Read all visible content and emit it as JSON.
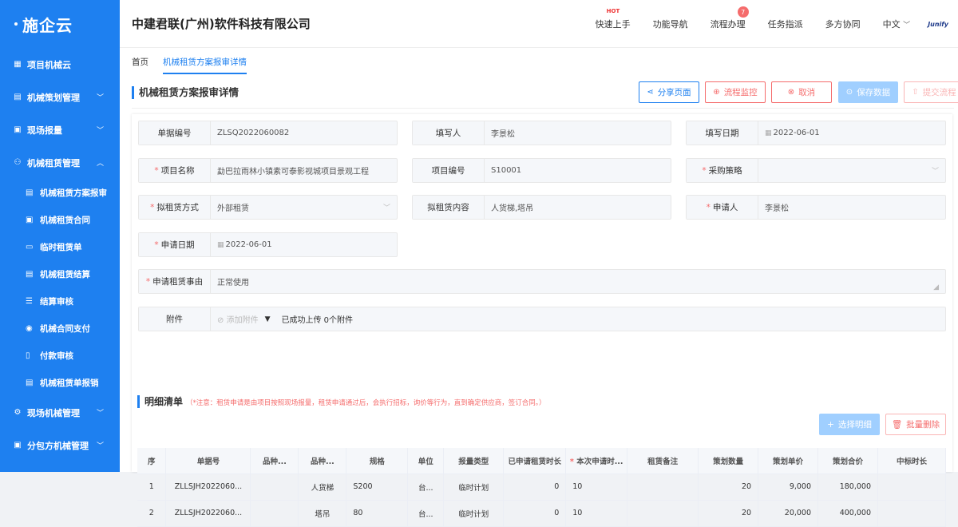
{
  "brand": {
    "logo_text": "施企云"
  },
  "sidebar": {
    "items": [
      {
        "label": "项目机械云"
      },
      {
        "label": "机械策划管理"
      },
      {
        "label": "现场报量"
      },
      {
        "label": "机械租赁管理"
      },
      {
        "label": "现场机械管理"
      },
      {
        "label": "分包方机械管理"
      }
    ],
    "sub_items": [
      {
        "label": "机械租赁方案报审"
      },
      {
        "label": "机械租赁合同"
      },
      {
        "label": "临时租赁单"
      },
      {
        "label": "机械租赁结算"
      },
      {
        "label": "结算审核"
      },
      {
        "label": "机械合同支付"
      },
      {
        "label": "付款审核"
      },
      {
        "label": "机械租赁单报销"
      }
    ]
  },
  "header": {
    "company": "中建君联(广州)软件科技有限公司",
    "nav": [
      "快速上手",
      "功能导航",
      "流程办理",
      "任务指派",
      "多方协同",
      "中文"
    ],
    "hot": "HOT",
    "badge": "7",
    "brandmark": "Junify"
  },
  "breadcrumb": [
    "首页",
    "机械租赁方案报审详情"
  ],
  "page": {
    "title": "机械租赁方案报审详情",
    "buttons": {
      "share": "分享页面",
      "monitor": "流程监控",
      "cancel": "取消",
      "save": "保存数据",
      "submit": "提交流程"
    }
  },
  "form": {
    "doc_no_label": "单据编号",
    "doc_no": "ZLSQ2022060082",
    "writer_label": "填写人",
    "writer": "李景松",
    "write_date_label": "填写日期",
    "write_date": "2022-06-01",
    "project_name_label": "项目名称",
    "project_name": "勐巴拉雨林小镇素可泰影视城项目景观工程",
    "project_no_label": "项目编号",
    "project_no": "S10001",
    "purchase_label": "采购策略",
    "purchase": "",
    "lease_mode_label": "拟租赁方式",
    "lease_mode": "外部租赁",
    "lease_content_label": "拟租赁内容",
    "lease_content": "人货梯,塔吊",
    "applicant_label": "申请人",
    "applicant": "李景松",
    "apply_date_label": "申请日期",
    "apply_date": "2022-06-01",
    "reason_label": "申请租赁事由",
    "reason": "正常使用",
    "attach_label": "附件",
    "attach_btn": "添加附件",
    "attach_status": "已成功上传 0个附件"
  },
  "detail": {
    "title": "明细清单",
    "note": "（*注意：租赁申请是由项目按照现场报量，租赁申请通过后，会执行招标，询价等行为，直到确定供应商，签订合同。）",
    "select_btn": "选择明细",
    "batch_del_btn": "批量删除",
    "columns": [
      "序",
      "单据号",
      "品种...",
      "品种...",
      "规格",
      "单位",
      "报量类型",
      "已申请租赁时长",
      "本次申请时...",
      "租赁备注",
      "策划数量",
      "策划单价",
      "策划合价",
      "中标时长"
    ],
    "rows": [
      [
        "1",
        "ZLLSJH2022060...",
        "",
        "人货梯",
        "S200",
        "台...",
        "临时计划",
        "0",
        "10",
        "",
        "20",
        "9,000",
        "180,000",
        ""
      ],
      [
        "2",
        "ZLLSJH2022060...",
        "",
        "塔吊",
        "80",
        "台...",
        "临时计划",
        "0",
        "10",
        "",
        "20",
        "20,000",
        "400,000",
        ""
      ]
    ]
  }
}
